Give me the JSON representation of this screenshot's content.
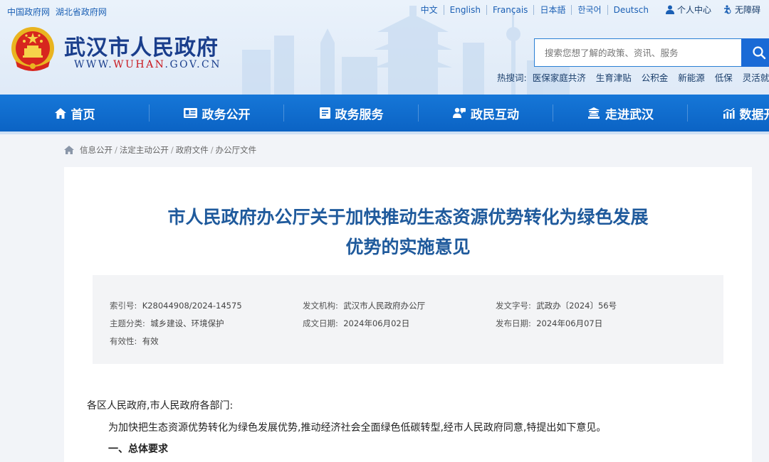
{
  "header": {
    "top_links": [
      "中国政府网",
      "湖北省政府网"
    ],
    "languages": [
      "中文",
      "English",
      "Français",
      "日本語",
      "한국어",
      "Deutsch"
    ],
    "personal_center": "个人中心",
    "accessibility": "无障碍",
    "site_title": "武汉市人民政府",
    "site_url_prefix": "WWW.",
    "site_url_highlight": "WUHAN",
    "site_url_suffix": ".GOV.CN",
    "search_placeholder": "搜索您想了解的政策、资讯、服务",
    "hot_label": "热搜词:",
    "hot_words": [
      "医保家庭共济",
      "生育津贴",
      "公积金",
      "新能源",
      "低保",
      "灵活就"
    ]
  },
  "nav": {
    "items": [
      {
        "label": "首页",
        "icon": "home-icon"
      },
      {
        "label": "政务公开",
        "icon": "id-card-icon"
      },
      {
        "label": "政务服务",
        "icon": "document-icon"
      },
      {
        "label": "政民互动",
        "icon": "people-icon"
      },
      {
        "label": "走进武汉",
        "icon": "building-icon"
      },
      {
        "label": "数据开放",
        "icon": "chart-icon"
      }
    ]
  },
  "breadcrumb": [
    "信息公开",
    "法定主动公开",
    "政府文件",
    "办公厅文件"
  ],
  "document": {
    "title_line1": "市人民政府办公厅关于加快推动生态资源优势转化为绿色发展",
    "title_line2": "优势的实施意见",
    "meta": {
      "index_label": "索引号:",
      "index_value": "K28044908/2024-14575",
      "issuer_label": "发文机构:",
      "issuer_value": "武汉市人民政府办公厅",
      "doc_no_label": "发文字号:",
      "doc_no_value": "武政办〔2024〕56号",
      "topic_label": "主题分类:",
      "topic_value": "城乡建设、环境保护",
      "created_label": "成文日期:",
      "created_value": "2024年06月02日",
      "published_label": "发布日期:",
      "published_value": "2024年06月07日",
      "validity_label": "有效性:",
      "validity_value": "有效"
    },
    "salutation": "各区人民政府,市人民政府各部门:",
    "paragraph1": "为加快把生态资源优势转化为绿色发展优势,推动经济社会全面绿色低碳转型,经市人民政府同意,特提出如下意见。",
    "section1": "一、总体要求"
  },
  "colors": {
    "nav_bg": "#0b63c4",
    "title_blue": "#1f5a9c",
    "brand_blue": "#1a3e8c",
    "url_red": "#c8161d"
  }
}
